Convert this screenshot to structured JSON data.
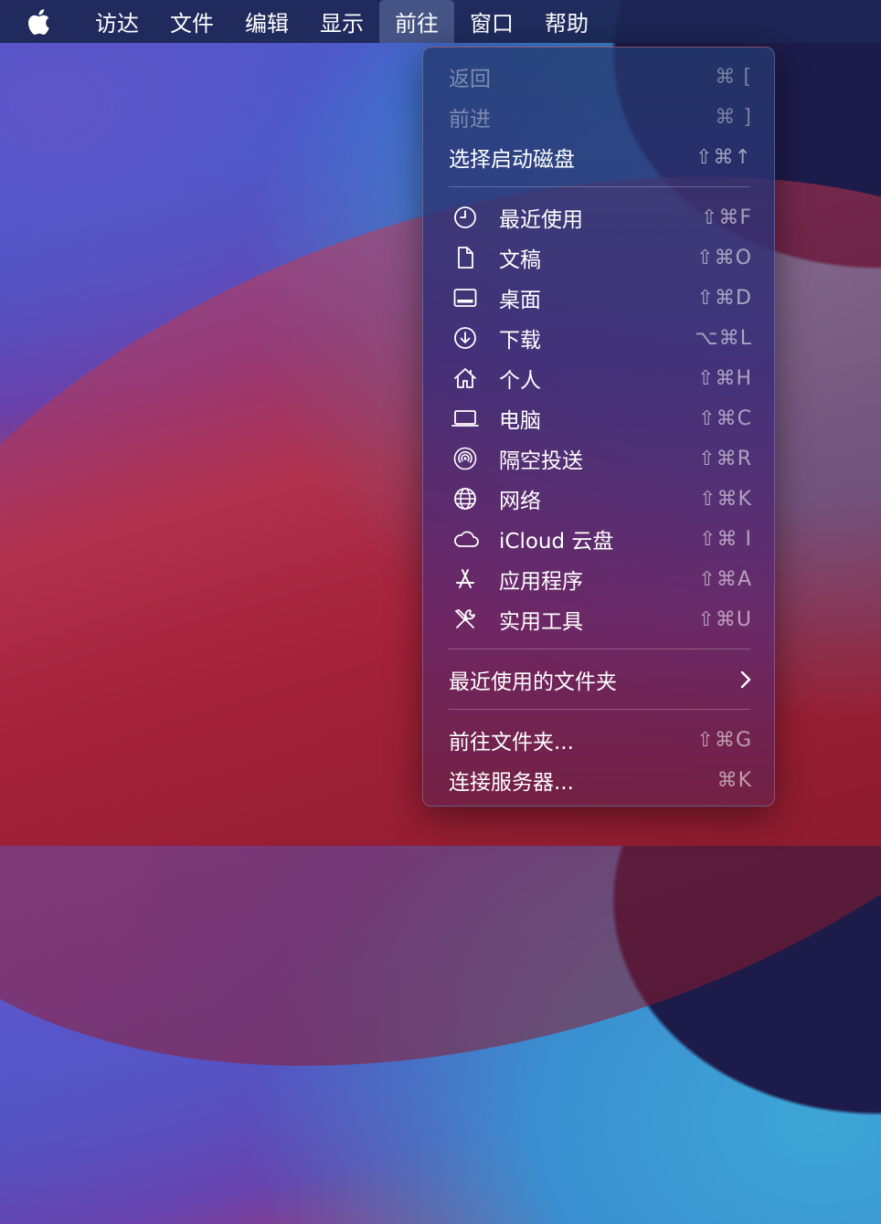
{
  "menubar": {
    "items": [
      "访达",
      "文件",
      "编辑",
      "显示",
      "前往",
      "窗口",
      "帮助"
    ]
  },
  "menu": {
    "back": {
      "label": "返回",
      "shortcut": "⌘ ["
    },
    "forward": {
      "label": "前进",
      "shortcut": "⌘ ]"
    },
    "startup_disk": {
      "label": "选择启动磁盘",
      "shortcut": "⇧⌘↑"
    },
    "places": [
      {
        "label": "最近使用",
        "shortcut": "⇧⌘F",
        "icon": "clock-icon"
      },
      {
        "label": "文稿",
        "shortcut": "⇧⌘O",
        "icon": "document-icon"
      },
      {
        "label": "桌面",
        "shortcut": "⇧⌘D",
        "icon": "desktop-icon"
      },
      {
        "label": "下载",
        "shortcut": "⌥⌘L",
        "icon": "download-icon"
      },
      {
        "label": "个人",
        "shortcut": "⇧⌘H",
        "icon": "home-icon"
      },
      {
        "label": "电脑",
        "shortcut": "⇧⌘C",
        "icon": "laptop-icon"
      },
      {
        "label": "隔空投送",
        "shortcut": "⇧⌘R",
        "icon": "airdrop-icon"
      },
      {
        "label": "网络",
        "shortcut": "⇧⌘K",
        "icon": "globe-icon"
      },
      {
        "label": "iCloud 云盘",
        "shortcut": "⇧⌘ I",
        "icon": "cloud-icon"
      },
      {
        "label": "应用程序",
        "shortcut": "⇧⌘A",
        "icon": "appstore-icon"
      },
      {
        "label": "实用工具",
        "shortcut": "⇧⌘U",
        "icon": "tools-icon"
      }
    ],
    "recent_folders": {
      "label": "最近使用的文件夹"
    },
    "go_to_folder": {
      "label": "前往文件夹...",
      "shortcut": "⇧⌘G"
    },
    "connect_server": {
      "label": "连接服务器...",
      "shortcut": "⌘K"
    }
  }
}
